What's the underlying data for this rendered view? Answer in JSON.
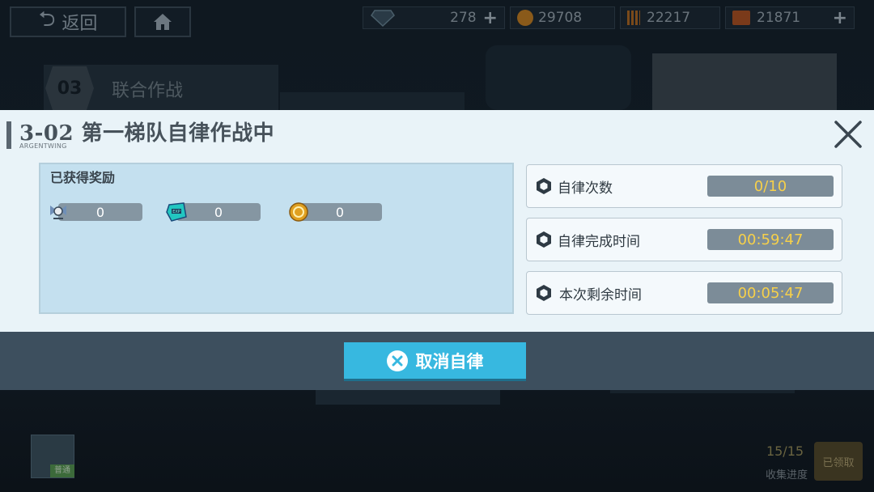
{
  "topbar": {
    "back_label": "返回",
    "resources": [
      {
        "name": "diamond",
        "icon": "diamond-icon",
        "value": "278",
        "has_plus": true,
        "color": "#4a5e6a"
      },
      {
        "name": "coin",
        "icon": "coin-icon",
        "value": "29708",
        "has_plus": false,
        "color": "#b87a22"
      },
      {
        "name": "ammo",
        "icon": "ammo-icon",
        "value": "22217",
        "has_plus": false,
        "color": "#9a5a20"
      },
      {
        "name": "supply",
        "icon": "supply-crate-icon",
        "value": "21871",
        "has_plus": true,
        "color": "#a04a20"
      }
    ]
  },
  "background": {
    "stage_number": "03",
    "stage_label": "联合作战",
    "progress": "15/15",
    "progress_label": "收集进度",
    "claimed_label": "已领取",
    "unit_tag": "普通"
  },
  "modal": {
    "title": "3-02 第一梯队自律作战中",
    "subtitle": "ARGENTWING",
    "rewards_title": "已获得奖励",
    "rewards": [
      {
        "icon": "fairy-icon",
        "value": "0"
      },
      {
        "icon": "exp-chip-icon",
        "value": "0"
      },
      {
        "icon": "gold-coin-icon",
        "value": "0"
      }
    ],
    "info": [
      {
        "label": "自律次数",
        "value": "0/10"
      },
      {
        "label": "自律完成时间",
        "value": "00:59:47"
      },
      {
        "label": "本次剩余时间",
        "value": "00:05:47"
      }
    ],
    "cancel_label": "取消自律"
  },
  "colors": {
    "accent": "#37b8e0",
    "value_text": "#f6d04a",
    "panel": "#c4e0ef",
    "footer": "#3d4f5e"
  }
}
